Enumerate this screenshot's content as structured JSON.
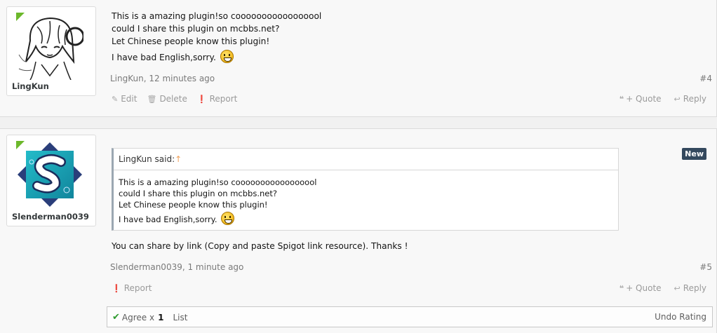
{
  "posts": [
    {
      "username": "LingKun",
      "avatar_icon": "manga-girl-avatar-icon",
      "message_lines": [
        "This is a amazing plugin!so cooooooooooooooool",
        "could I share this plugin on mcbbs.net?",
        "Let Chinese people know this plugin!",
        "I have bad English,sorry."
      ],
      "emoji_icon": "grin-emoji-icon",
      "meta": "LingKun, 12 minutes ago",
      "post_number": "#4",
      "controls": {
        "edit": "Edit",
        "delete": "Delete",
        "report": "Report"
      },
      "actions": {
        "quote": "+ Quote",
        "reply": "Reply"
      }
    },
    {
      "username": "Slenderman0039",
      "avatar_icon": "letter-s-logo-avatar-icon",
      "badge": "New",
      "quote": {
        "author_said": "LingKun said:",
        "arrow": "↑",
        "lines": [
          "This is a amazing plugin!so cooooooooooooooool",
          "could I share this plugin on mcbbs.net?",
          "Let Chinese people know this plugin!",
          "I have bad English,sorry."
        ]
      },
      "message": "You can share by link (Copy and paste Spigot link resource). Thanks !",
      "meta": "Slenderman0039, 1 minute ago",
      "post_number": "#5",
      "controls": {
        "report": "Report"
      },
      "actions": {
        "quote": "+ Quote",
        "reply": "Reply"
      },
      "rating": {
        "label": "Agree x",
        "count": "1",
        "list": "List",
        "undo": "Undo Rating"
      }
    }
  ],
  "colors": {
    "online": "#6cb82b",
    "badge_bg": "#34495e",
    "quote_border": "#9ba7b2",
    "agree": "#2e9a2e"
  }
}
